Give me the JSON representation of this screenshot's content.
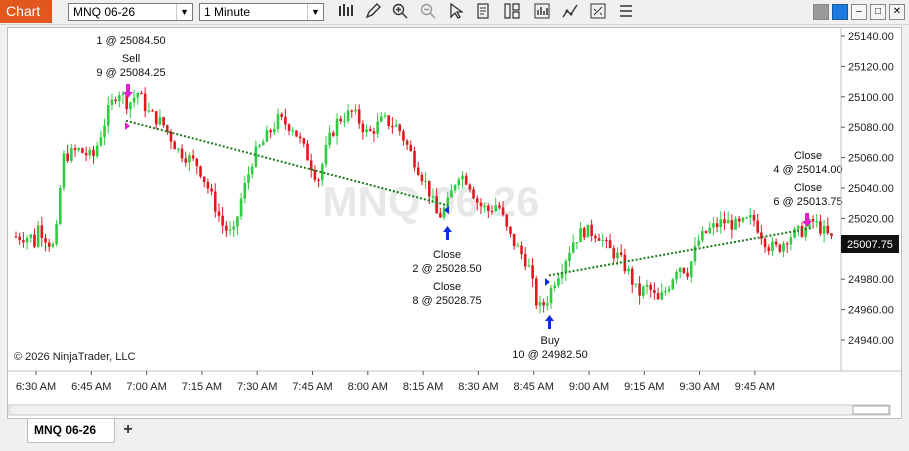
{
  "app": {
    "tab_label": "Chart",
    "accent": "#e2571e"
  },
  "toolbar": {
    "instrument": "MNQ 06-26",
    "interval": "1 Minute",
    "icons": [
      "bar-type-icon",
      "draw-pencil-icon",
      "zoom-in-icon",
      "zoom-out-icon",
      "pointer-icon",
      "properties-icon",
      "data-box-icon",
      "strategy-icon",
      "indicators-icon",
      "templates-icon"
    ]
  },
  "window_controls": [
    "gray-square-icon",
    "blue-square-icon",
    "minimize-icon",
    "maximize-icon",
    "close-icon"
  ],
  "chart": {
    "watermark": "MNQ 06-26",
    "copyright": "© 2026 NinjaTrader, LLC",
    "last_price": "25007.75",
    "colors": {
      "up": "#2ecc40",
      "down": "#e0191f",
      "trade_line": "#1a7a1a",
      "arrow_blue": "#0a2de0",
      "arrow_magenta": "#e020d0",
      "last_price_bg": "#111111"
    }
  },
  "chart_data": {
    "type": "candlestick",
    "x_ticks": [
      "6:30 AM",
      "6:45 AM",
      "7:00 AM",
      "7:15 AM",
      "7:30 AM",
      "7:45 AM",
      "8:00 AM",
      "8:15 AM",
      "8:30 AM",
      "8:45 AM",
      "9:00 AM",
      "9:15 AM",
      "9:30 AM",
      "9:45 AM"
    ],
    "y_ticks": [
      "25140.00",
      "25120.00",
      "25100.00",
      "25080.00",
      "25060.00",
      "25040.00",
      "25020.00",
      "25000.00",
      "24980.00",
      "24960.00",
      "24940.00"
    ],
    "ylim": [
      24930,
      25148
    ],
    "path": [
      [
        24,
        24996
      ],
      [
        30,
        25015
      ],
      [
        40,
        25005
      ],
      [
        47,
        25000
      ],
      [
        55,
        25060
      ],
      [
        70,
        25065
      ],
      [
        85,
        25060
      ],
      [
        100,
        25090
      ],
      [
        110,
        25105
      ],
      [
        120,
        25095
      ],
      [
        130,
        25103
      ],
      [
        140,
        25090
      ],
      [
        155,
        25082
      ],
      [
        170,
        25065
      ],
      [
        190,
        25055
      ],
      [
        200,
        25040
      ],
      [
        215,
        25015
      ],
      [
        225,
        25008
      ],
      [
        232,
        25030
      ],
      [
        245,
        25060
      ],
      [
        255,
        25070
      ],
      [
        270,
        25085
      ],
      [
        285,
        25080
      ],
      [
        300,
        25060
      ],
      [
        310,
        25045
      ],
      [
        320,
        25070
      ],
      [
        330,
        25085
      ],
      [
        345,
        25090
      ],
      [
        360,
        25075
      ],
      [
        375,
        25085
      ],
      [
        390,
        25080
      ],
      [
        405,
        25060
      ],
      [
        420,
        25040
      ],
      [
        430,
        25020
      ],
      [
        440,
        25030
      ],
      [
        450,
        25050
      ],
      [
        460,
        25045
      ],
      [
        470,
        25030
      ],
      [
        480,
        25025
      ],
      [
        490,
        25030
      ],
      [
        500,
        25010
      ],
      [
        510,
        25000
      ],
      [
        520,
        24990
      ],
      [
        530,
        24960
      ],
      [
        538,
        24965
      ],
      [
        547,
        24980
      ],
      [
        555,
        24990
      ],
      [
        565,
        25005
      ],
      [
        575,
        25012
      ],
      [
        590,
        25010
      ],
      [
        600,
        25000
      ],
      [
        610,
        24995
      ],
      [
        620,
        24985
      ],
      [
        630,
        24970
      ],
      [
        640,
        24975
      ],
      [
        650,
        24965
      ],
      [
        660,
        24975
      ],
      [
        670,
        24990
      ],
      [
        680,
        24985
      ],
      [
        690,
        25005
      ],
      [
        700,
        25012
      ],
      [
        715,
        25018
      ],
      [
        730,
        25015
      ],
      [
        745,
        25020
      ],
      [
        760,
        25002
      ],
      [
        770,
        25000
      ],
      [
        780,
        25008
      ],
      [
        795,
        25012
      ],
      [
        805,
        25018
      ],
      [
        815,
        25012
      ],
      [
        825,
        25005
      ],
      [
        832,
        25008
      ]
    ],
    "executions": [
      {
        "label": "1 @ 25084.50",
        "side": "annotation",
        "time_index": 21,
        "price": 25084.5
      },
      {
        "label": "Sell",
        "side": "sell",
        "qty_price": "9 @ 25084.25",
        "time_index": 21,
        "price": 25084.25
      },
      {
        "label": "Close",
        "side": "cover",
        "qty_price": "2 @ 25028.50",
        "time_index": 106,
        "price": 25028.5
      },
      {
        "label": "Close",
        "side": "cover",
        "qty_price": "8 @ 25028.75",
        "time_index": 106,
        "price": 25028.75
      },
      {
        "label": "Buy",
        "side": "buy",
        "qty_price": "10 @ 24982.50",
        "time_index": 136,
        "price": 24982.5
      },
      {
        "label": "Close",
        "side": "sell",
        "qty_price": "4 @ 25014.00",
        "time_index": 199,
        "price": 25014.0
      },
      {
        "label": "Close",
        "side": "sell",
        "qty_price": "6 @ 25013.75",
        "time_index": 199,
        "price": 25013.75
      }
    ],
    "trade_lines": [
      {
        "from_price": 25084.25,
        "to_price": 25028.5
      },
      {
        "from_price": 24982.5,
        "to_price": 25013.75
      }
    ],
    "grid": false,
    "legend": "none"
  },
  "bottom": {
    "instrument_tab": "MNQ 06-26",
    "add_tab": "+"
  }
}
